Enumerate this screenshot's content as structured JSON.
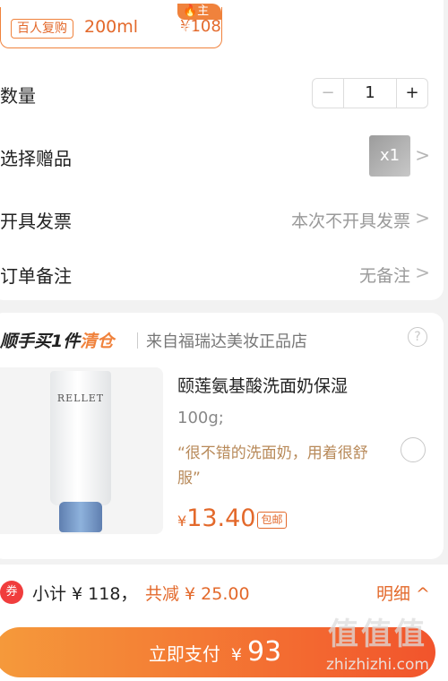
{
  "spec": {
    "badge": "百人复购",
    "size": "200ml",
    "price": "¥108",
    "tag": "🔥主推"
  },
  "quantity": {
    "label": "数量",
    "minus": "−",
    "value": "1",
    "plus": "+"
  },
  "gift": {
    "label": "选择赠品",
    "thumb_text": "x1"
  },
  "invoice": {
    "label": "开具发票",
    "value": "本次不开具发票"
  },
  "note": {
    "label": "订单备注",
    "value": "无备注"
  },
  "promo": {
    "title_prefix": "顺手买1件",
    "title_accent": "清仓",
    "source": "来自福瑞达美妆正品店",
    "help": "?"
  },
  "product": {
    "brand": "RELLET",
    "name": "颐莲氨基酸洗面奶保湿",
    "spec": "100g;",
    "review": "“很不错的洗面奶，用着很舒服”",
    "currency": "¥",
    "price": "13.40",
    "shipping_tag": "包邮"
  },
  "summary": {
    "coupon_icon": "券",
    "subtotal": "小计 ¥ 118，",
    "discount": "共减 ¥ 25.00",
    "detail": "明细 ^"
  },
  "pay": {
    "label": "立即支付",
    "currency": "¥",
    "amount": "93"
  },
  "watermark": {
    "text": "值值值",
    "url": "zhizhizhi.com"
  },
  "colors": {
    "accent": "#f0823c",
    "price": "#e3692b",
    "pay_gradient_start": "#f59a3b",
    "pay_gradient_end": "#f2542c"
  }
}
